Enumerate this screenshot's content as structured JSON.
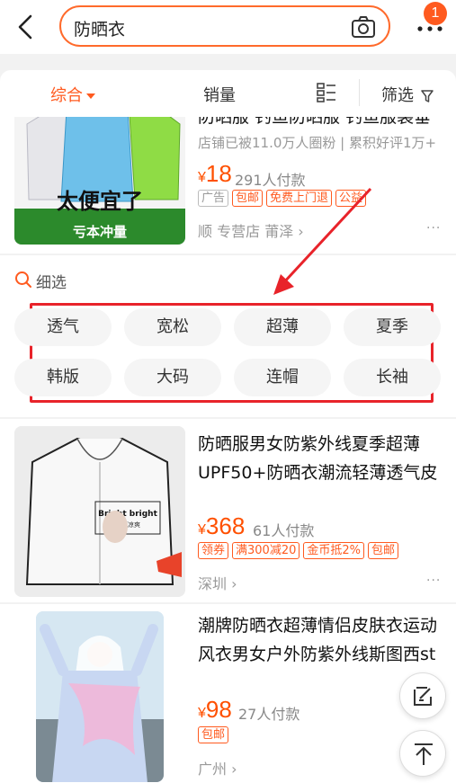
{
  "header": {
    "search_query": "防晒衣",
    "notification_count": "1"
  },
  "sortbar": {
    "sort_label": "综合",
    "sales_label": "销量",
    "filter_label": "筛选"
  },
  "products": [
    {
      "title": "防晒服 钓鱼防晒服 钓鱼服装垂",
      "subtitle": "店铺已被11.0万人圈粉 | 累积好评1万+",
      "price_symbol": "¥",
      "price": "18",
      "sales": "291人付款",
      "tags": [
        "广告",
        "包邮",
        "免费上门退",
        "公益"
      ],
      "shop": "顺 专营店",
      "location": "莆泽",
      "image_banner": "太便宜了",
      "image_subbanner": "亏本冲量"
    },
    {
      "title": "防晒服男女防紫外线夏季超薄UPF50+防晒衣潮流轻薄透气皮",
      "price_symbol": "¥",
      "price": "368",
      "sales": "61人付款",
      "tags": [
        "领券",
        "满300减20",
        "金币抵2%",
        "包邮"
      ],
      "location": "深圳",
      "image_label": "Bright bright",
      "image_sublabel": "轻薄凉爽"
    },
    {
      "title": "潮牌防晒衣超薄情侣皮肤衣运动风衣男女户外防紫外线斯图西st",
      "price_symbol": "¥",
      "price": "98",
      "sales": "27人付款",
      "tags": [
        "包邮"
      ],
      "location": "广州"
    }
  ],
  "refine": {
    "title": "细选",
    "chips": [
      "透气",
      "宽松",
      "超薄",
      "夏季",
      "韩版",
      "大码",
      "连帽",
      "长袖"
    ]
  },
  "icons": {
    "back": "back-arrow-icon",
    "camera": "camera-icon",
    "more": "more-dots-icon",
    "layout": "grid-list-icon",
    "filter": "funnel-icon",
    "search": "search-icon",
    "edit": "edit-icon",
    "top": "back-to-top-icon"
  },
  "colors": {
    "accent": "#ff5a1f",
    "price": "#ff5000",
    "highlight_box": "#e8232a",
    "annotation_arrow": "#e8232a"
  }
}
